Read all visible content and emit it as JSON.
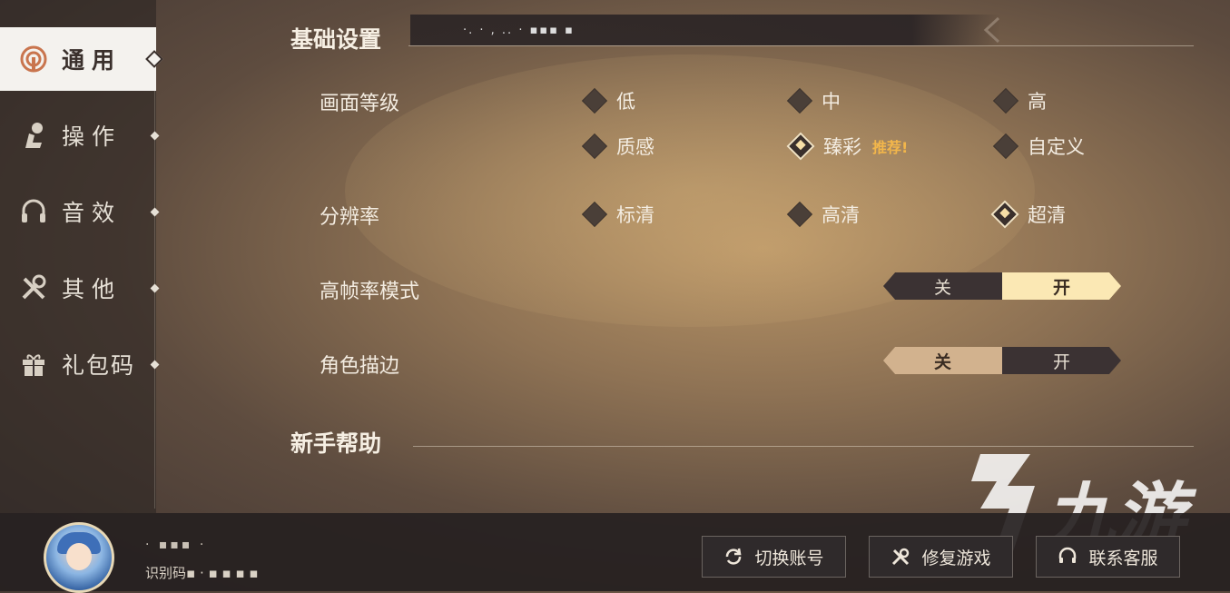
{
  "sidebar": {
    "items": [
      {
        "label": "通用",
        "icon": "signal-icon",
        "active": true
      },
      {
        "label": "操作",
        "icon": "pointer-hand-icon",
        "active": false
      },
      {
        "label": "音效",
        "icon": "headphones-icon",
        "active": false
      },
      {
        "label": "其他",
        "icon": "tools-icon",
        "active": false
      },
      {
        "label": "礼包码",
        "icon": "gift-icon",
        "active": false
      }
    ]
  },
  "main": {
    "basic_title": "基础设置",
    "title_band_text": "·. · , .. · ▪▪▪ ▪",
    "quality": {
      "label": "画面等级",
      "options": [
        "低",
        "中",
        "高",
        "质感",
        "臻彩",
        "自定义"
      ],
      "selected": "臻彩",
      "recommend_tag": "推荐!"
    },
    "resolution": {
      "label": "分辨率",
      "options": [
        "标清",
        "高清",
        "超清"
      ],
      "selected": "超清"
    },
    "high_fps": {
      "label": "高帧率模式",
      "off": "关",
      "on": "开",
      "value": "开"
    },
    "outline": {
      "label": "角色描边",
      "off": "关",
      "on": "开",
      "value": "关"
    },
    "help_title": "新手帮助"
  },
  "footer": {
    "username": "· ▪▪▪ ·",
    "uid_label": "识别码",
    "uid_value": "▪ · ▪ ▪ ▪ ▪",
    "buttons": [
      {
        "label": "切换账号",
        "icon": "refresh-icon"
      },
      {
        "label": "修复游戏",
        "icon": "wrench-icon"
      },
      {
        "label": "联系客服",
        "icon": "headset-icon"
      }
    ]
  },
  "watermark": {
    "text": "九游"
  },
  "colors": {
    "selected_toggle": "#fbe8b4",
    "recommend": "#f2b64b",
    "active_tab": "#f4f2ee"
  }
}
